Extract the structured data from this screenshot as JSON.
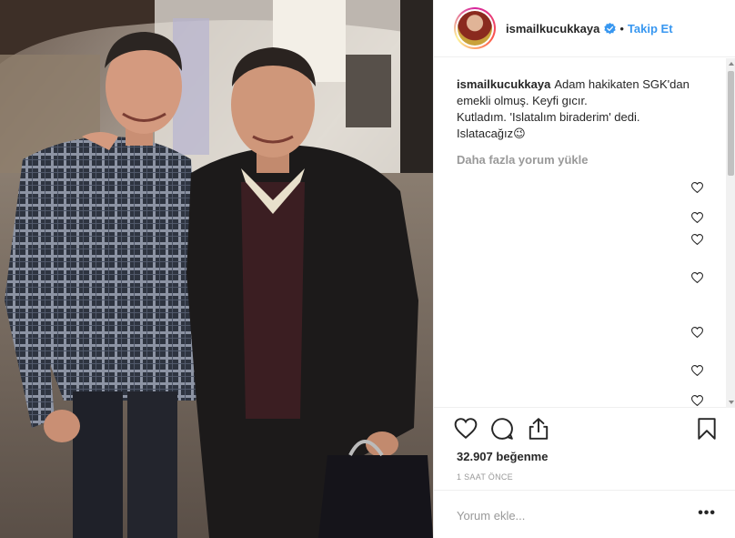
{
  "post": {
    "username": "ismailkucukkaya",
    "follow_label": "Takip Et",
    "caption_user": "ismailkucukkaya",
    "caption_line1": "Adam hakikaten SGK'dan emekli olmuş. Keyfi gıcır.",
    "caption_line2": "Kutladım. 'Islatalım biraderim' dedi.",
    "caption_line3": "Islatacağız",
    "emoji": "😉",
    "load_more": "Daha fazla yorum yükle",
    "likes": "32.907 beğenme",
    "time": "1 SAAT ÖNCE",
    "comment_placeholder": "Yorum ekle...",
    "more_options": "•••"
  },
  "colors": {
    "accent": "#3897f0",
    "text": "#262626",
    "muted": "#999999",
    "border": "#efefef"
  },
  "icons": {
    "verified": "verified-badge-icon",
    "like": "heart-icon",
    "comment": "comment-bubble-icon",
    "share": "share-icon",
    "save": "bookmark-icon",
    "comment_like": "small-heart-icon"
  }
}
